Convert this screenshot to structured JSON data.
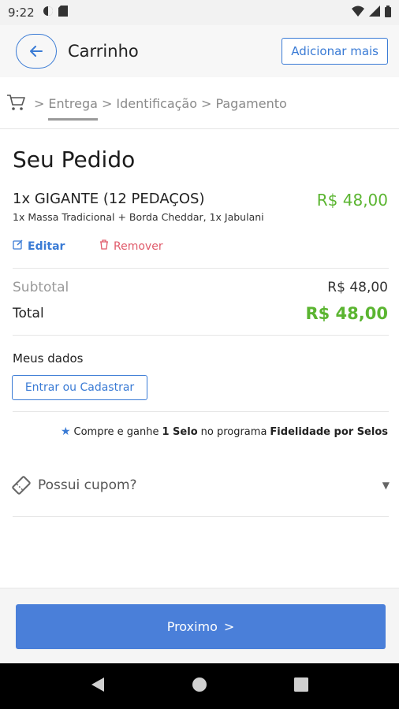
{
  "status_bar": {
    "time": "9:22"
  },
  "header": {
    "title": "Carrinho",
    "add_more_label": "Adicionar mais"
  },
  "steps": {
    "items": [
      "Entrega",
      "Identificação",
      "Pagamento"
    ],
    "separator": ">"
  },
  "order": {
    "title": "Seu Pedido",
    "item": {
      "name": "1x GIGANTE (12 PEDAÇOS)",
      "description": "1x Massa Tradicional + Borda Cheddar, 1x Jabulani",
      "price": "R$ 48,00"
    },
    "edit_label": "Editar",
    "remove_label": "Remover"
  },
  "totals": {
    "subtotal_label": "Subtotal",
    "subtotal_value": "R$ 48,00",
    "total_label": "Total",
    "total_value": "R$ 48,00"
  },
  "my_data": {
    "label": "Meus dados",
    "login_label": "Entrar ou Cadastrar"
  },
  "loyalty": {
    "prefix": "Compre e ganhe",
    "stamp": "1 Selo",
    "middle": "no programa",
    "program": "Fidelidade por Selos"
  },
  "coupon": {
    "label": "Possui cupom?"
  },
  "footer": {
    "next_label": "Proximo",
    "next_arrow": ">"
  },
  "colors": {
    "accent": "#3a7bd5",
    "price_green": "#5bb531",
    "remove_red": "#e05a6a"
  }
}
